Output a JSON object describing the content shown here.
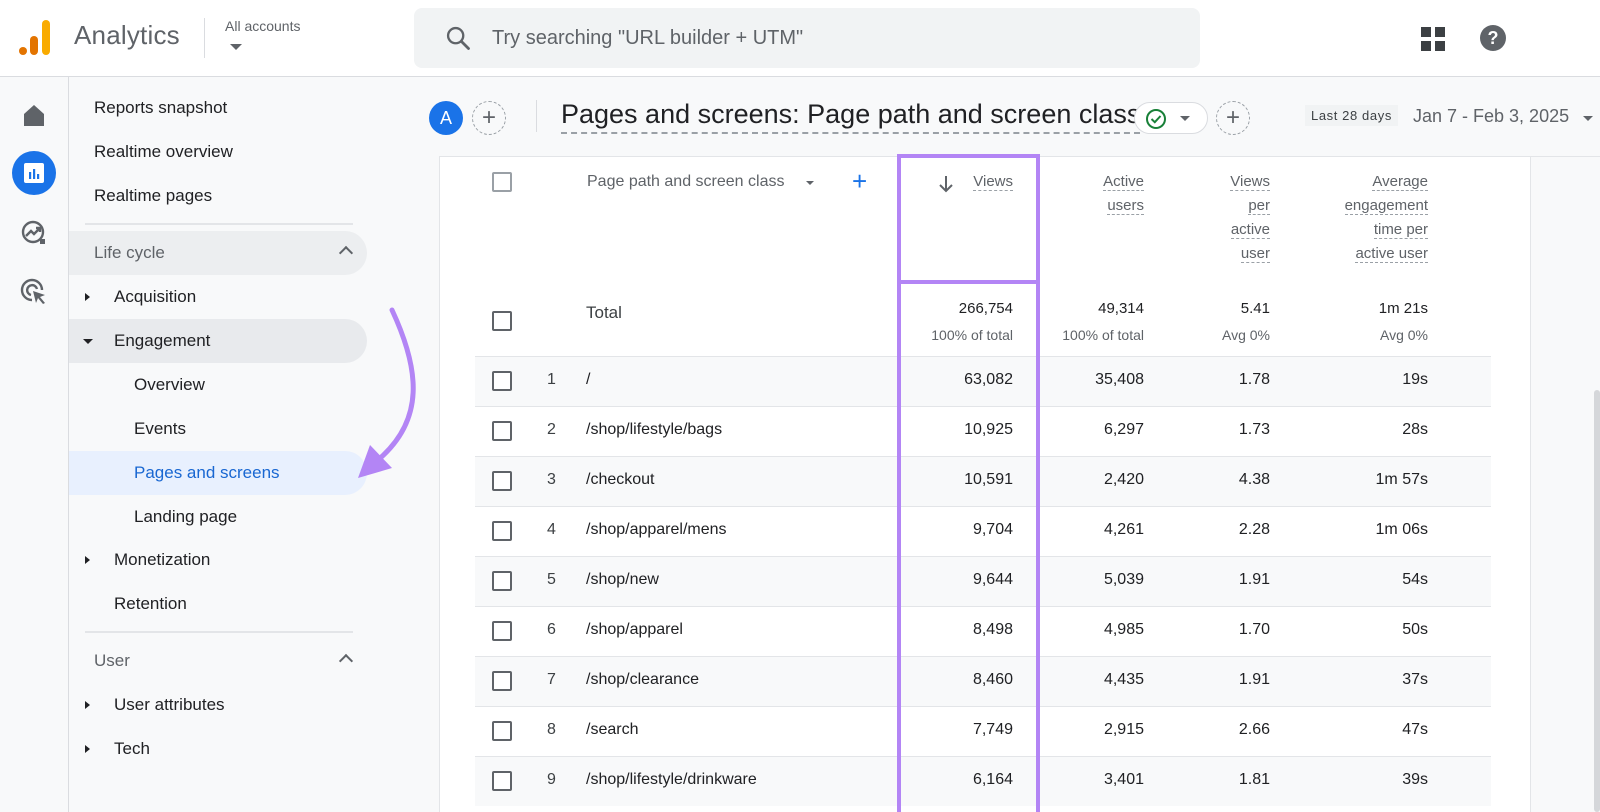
{
  "topbar": {
    "app_name": "Analytics",
    "account_selector": "All accounts",
    "search_placeholder": "Try searching \"URL builder + UTM\"",
    "icons": [
      "analytics-logo",
      "search-icon",
      "apps-grid-icon",
      "help-icon"
    ]
  },
  "rail": {
    "items": [
      {
        "name": "home",
        "icon": "home-icon",
        "active": false
      },
      {
        "name": "reports",
        "icon": "bar-chart-icon",
        "active": true
      },
      {
        "name": "explore",
        "icon": "explore-trend-icon",
        "active": false
      },
      {
        "name": "advertising",
        "icon": "advertising-target-icon",
        "active": false
      }
    ]
  },
  "nav": {
    "top_items": [
      "Reports snapshot",
      "Realtime overview",
      "Realtime pages"
    ],
    "lifecycle": {
      "label": "Life cycle",
      "items": [
        {
          "label": "Acquisition",
          "expanded": false
        },
        {
          "label": "Engagement",
          "expanded": true,
          "children": [
            "Overview",
            "Events",
            "Pages and screens",
            "Landing page"
          ],
          "selected": "Pages and screens"
        },
        {
          "label": "Monetization",
          "expanded": false
        },
        {
          "label": "Retention",
          "expanded": null
        }
      ]
    },
    "user": {
      "label": "User",
      "items": [
        {
          "label": "User attributes",
          "expanded": false
        },
        {
          "label": "Tech",
          "expanded": false
        }
      ]
    }
  },
  "report": {
    "avatar_letter": "A",
    "title": "Pages and screens: Page path and screen class",
    "date_preset": "Last 28 days",
    "date_range": "Jan 7 - Feb 3, 2025"
  },
  "table": {
    "dimension_header": "Page path and screen class",
    "columns": [
      {
        "key": "views",
        "lines": [
          "Views"
        ],
        "sorted": "desc",
        "highlighted": true
      },
      {
        "key": "active_users",
        "lines": [
          "Active",
          "users"
        ]
      },
      {
        "key": "views_per_user",
        "lines": [
          "Views",
          "per",
          "active",
          "user"
        ]
      },
      {
        "key": "avg_engagement",
        "lines": [
          "Average",
          "engagement",
          "time per",
          "active user"
        ]
      }
    ],
    "total": {
      "label": "Total",
      "views": "266,754",
      "views_sub": "100% of total",
      "active_users": "49,314",
      "active_users_sub": "100% of total",
      "views_per_user": "5.41",
      "views_per_user_sub": "Avg 0%",
      "avg_engagement": "1m 21s",
      "avg_engagement_sub": "Avg 0%"
    },
    "rows": [
      {
        "idx": "1",
        "path": "/",
        "views": "63,082",
        "active_users": "35,408",
        "views_per_user": "1.78",
        "avg_engagement": "19s"
      },
      {
        "idx": "2",
        "path": "/shop/lifestyle/bags",
        "views": "10,925",
        "active_users": "6,297",
        "views_per_user": "1.73",
        "avg_engagement": "28s"
      },
      {
        "idx": "3",
        "path": "/checkout",
        "views": "10,591",
        "active_users": "2,420",
        "views_per_user": "4.38",
        "avg_engagement": "1m 57s"
      },
      {
        "idx": "4",
        "path": "/shop/apparel/mens",
        "views": "9,704",
        "active_users": "4,261",
        "views_per_user": "2.28",
        "avg_engagement": "1m 06s"
      },
      {
        "idx": "5",
        "path": "/shop/new",
        "views": "9,644",
        "active_users": "5,039",
        "views_per_user": "1.91",
        "avg_engagement": "54s"
      },
      {
        "idx": "6",
        "path": "/shop/apparel",
        "views": "8,498",
        "active_users": "4,985",
        "views_per_user": "1.70",
        "avg_engagement": "50s"
      },
      {
        "idx": "7",
        "path": "/shop/clearance",
        "views": "8,460",
        "active_users": "4,435",
        "views_per_user": "1.91",
        "avg_engagement": "37s"
      },
      {
        "idx": "8",
        "path": "/search",
        "views": "7,749",
        "active_users": "2,915",
        "views_per_user": "2.66",
        "avg_engagement": "47s"
      },
      {
        "idx": "9",
        "path": "/shop/lifestyle/drinkware",
        "views": "6,164",
        "active_users": "3,401",
        "views_per_user": "1.81",
        "avg_engagement": "39s"
      }
    ]
  },
  "colors": {
    "accent_blue": "#1a73e8",
    "selected_nav_bg": "#e8f0fe",
    "selected_nav_text": "#1967d2",
    "highlight_annotation": "#b385f5",
    "status_check_green": "#188038",
    "logo_orange_dark": "#e37400",
    "logo_orange_light": "#f9ab00"
  }
}
